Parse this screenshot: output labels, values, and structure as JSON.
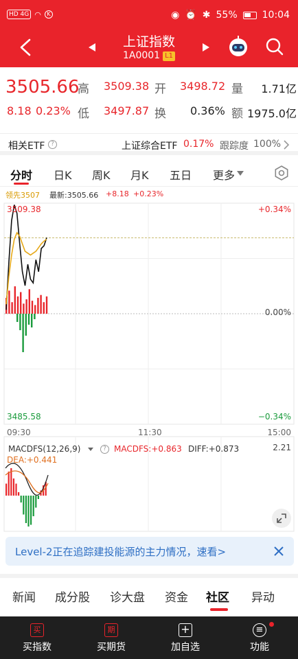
{
  "status_bar": {
    "network": "HD 4G",
    "battery": "55%",
    "time": "10:04"
  },
  "header": {
    "title": "上证指数",
    "code": "1A0001",
    "level_badge": "L1"
  },
  "quote": {
    "price": "3505.66",
    "change": "8.18",
    "change_pct": "0.23%",
    "high_label": "高",
    "high": "3509.38",
    "open_label": "开",
    "open": "3498.72",
    "volume_label": "量",
    "volume": "1.71亿",
    "low_label": "低",
    "low": "3497.87",
    "turnover_label": "换",
    "turnover": "0.36%",
    "amount_label": "额",
    "amount": "1975.0亿"
  },
  "etf": {
    "label": "相关ETF",
    "info_icon": "?",
    "name": "上证综合ETF",
    "pct": "0.17%",
    "tracking_label": "跟踪度",
    "tracking": "100%"
  },
  "tabs": [
    "分时",
    "日K",
    "周K",
    "月K",
    "五日",
    "更多"
  ],
  "chart_info": {
    "lead_label": "领先3507",
    "latest_text": "最新:3505.66",
    "change_text": "+8.18",
    "pct_text": "+0.23%",
    "top_price": "3509.38",
    "bottom_price": "3485.58",
    "top_pct": "+0.34%",
    "mid_pct": "0.00%",
    "bottom_pct": "−0.34%",
    "time_start": "09:30",
    "time_mid": "11:30",
    "time_end": "15:00"
  },
  "macd": {
    "label": "MACDFS(12,26,9)",
    "value_text": "MACDFS:+0.863",
    "diff_text": "DIFF:+0.873",
    "dea_text": "DEA:+0.441",
    "top_value": "2.21"
  },
  "chart_data": {
    "type": "line",
    "title": "",
    "x_range": [
      "09:30",
      "15:00"
    ],
    "ylim": [
      3485.58,
      3509.38
    ],
    "prev_close": 3497.48,
    "series": [
      {
        "color": "#111111",
        "values": [
          3497.9,
          3503.0,
          3507.5,
          3509.2,
          3508.3,
          3505.0,
          3502.0,
          3500.5,
          3502.8,
          3501.2,
          3500.8,
          3503.3,
          3502.0,
          3504.5,
          3504.8,
          3505.66
        ]
      },
      {
        "color": "#e6a817",
        "values": [
          3498.5,
          3501.5,
          3503.8,
          3505.5,
          3506.2,
          3505.8,
          3505.0,
          3504.2,
          3504.0,
          3503.8,
          3504.0,
          3504.2,
          3504.6,
          3505.0,
          3505.3,
          3505.5
        ]
      }
    ],
    "volume_bars": [
      0.55,
      0.8,
      0.4,
      0.95,
      0.6,
      0.75,
      0.35,
      0.5,
      0.85,
      0.45,
      0.3,
      0.55,
      0.65,
      0.4,
      0.6
    ],
    "volume_bars_below": [
      0.15,
      0.3,
      0.7,
      0.4,
      0.2,
      0.25,
      0.1,
      0.0,
      0.0,
      0.0,
      0.0,
      0.0,
      0.0,
      0.0,
      0.0
    ],
    "macd_hist": [
      0.35,
      0.7,
      0.8,
      0.5,
      0.35,
      0.1,
      -0.2,
      -0.55,
      -0.8,
      -0.9,
      -0.85,
      -0.6,
      -0.35,
      -0.1,
      0.15,
      0.3,
      0.4
    ]
  },
  "banner": {
    "text": "Level-2正在追踪建投能源的主力情况，速看>"
  },
  "news_tabs": [
    "新闻",
    "成分股",
    "诊大盘",
    "资金",
    "社区",
    "异动"
  ],
  "bottom_bar": [
    {
      "icon": "买",
      "label": "买指数"
    },
    {
      "icon": "期",
      "label": "买期货"
    },
    {
      "icon": "+",
      "label": "加自选"
    },
    {
      "icon": "≡",
      "label": "功能"
    }
  ]
}
